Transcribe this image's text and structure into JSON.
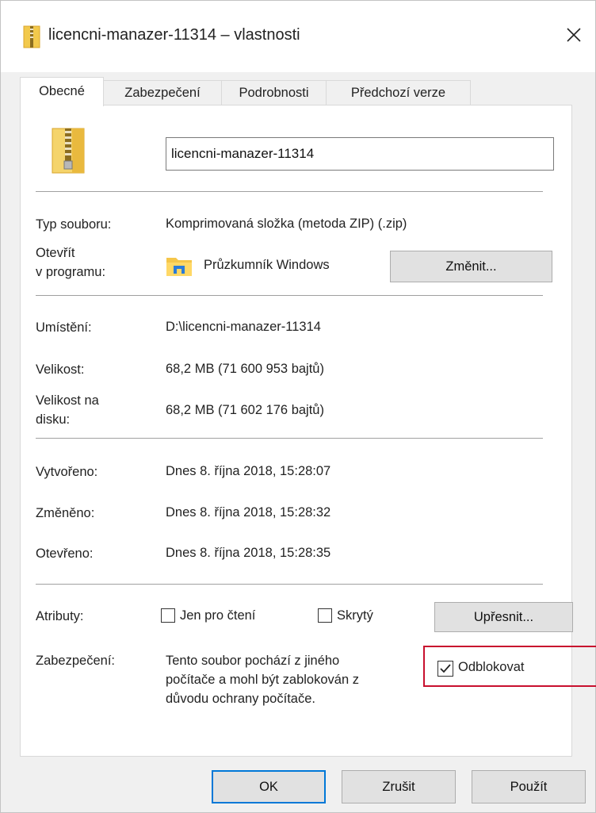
{
  "window": {
    "title": "licencni-manazer-11314 – vlastnosti",
    "icon": "zip-folder-icon"
  },
  "tabs": [
    {
      "label": "Obecné",
      "active": true
    },
    {
      "label": "Zabezpečení",
      "active": false
    },
    {
      "label": "Podrobnosti",
      "active": false
    },
    {
      "label": "Předchozí verze",
      "active": false
    }
  ],
  "general": {
    "file_name": "licencni-manazer-11314",
    "type_label": "Typ souboru:",
    "type_value": "Komprimovaná složka (metoda ZIP) (.zip)",
    "opens_label_1": "Otevřít",
    "opens_label_2": "v programu:",
    "opens_value": "Průzkumník Windows",
    "change_button": "Změnit...",
    "location_label": "Umístění:",
    "location_value": "D:\\licencni-manazer-11314",
    "size_label": "Velikost:",
    "size_value": "68,2 MB (71 600 953 bajtů)",
    "disk_size_label_1": "Velikost na",
    "disk_size_label_2": "disku:",
    "disk_size_value": "68,2 MB (71 602 176 bajtů)",
    "created_label": "Vytvořeno:",
    "created_value": "Dnes 8. října 2018, 15:28:07",
    "modified_label": "Změněno:",
    "modified_value": "Dnes 8. října 2018, 15:28:32",
    "accessed_label": "Otevřeno:",
    "accessed_value": "Dnes 8. října 2018, 15:28:35",
    "attributes_label": "Atributy:",
    "readonly_label": "Jen pro čtení",
    "readonly_checked": false,
    "hidden_label": "Skrytý",
    "hidden_checked": false,
    "advanced_button": "Upřesnit...",
    "security_label": "Zabezpečení:",
    "security_text_1": "Tento soubor pochází z jiného",
    "security_text_2": "počítače a mohl být zablokován z",
    "security_text_3": "důvodu ochrany počítače.",
    "unblock_label": "Odblokovat",
    "unblock_checked": true
  },
  "footer": {
    "ok": "OK",
    "cancel": "Zrušit",
    "apply": "Použít"
  },
  "colors": {
    "accent": "#0078d7",
    "highlight_box": "#c8102e",
    "folder_yellow": "#f2c94c"
  }
}
